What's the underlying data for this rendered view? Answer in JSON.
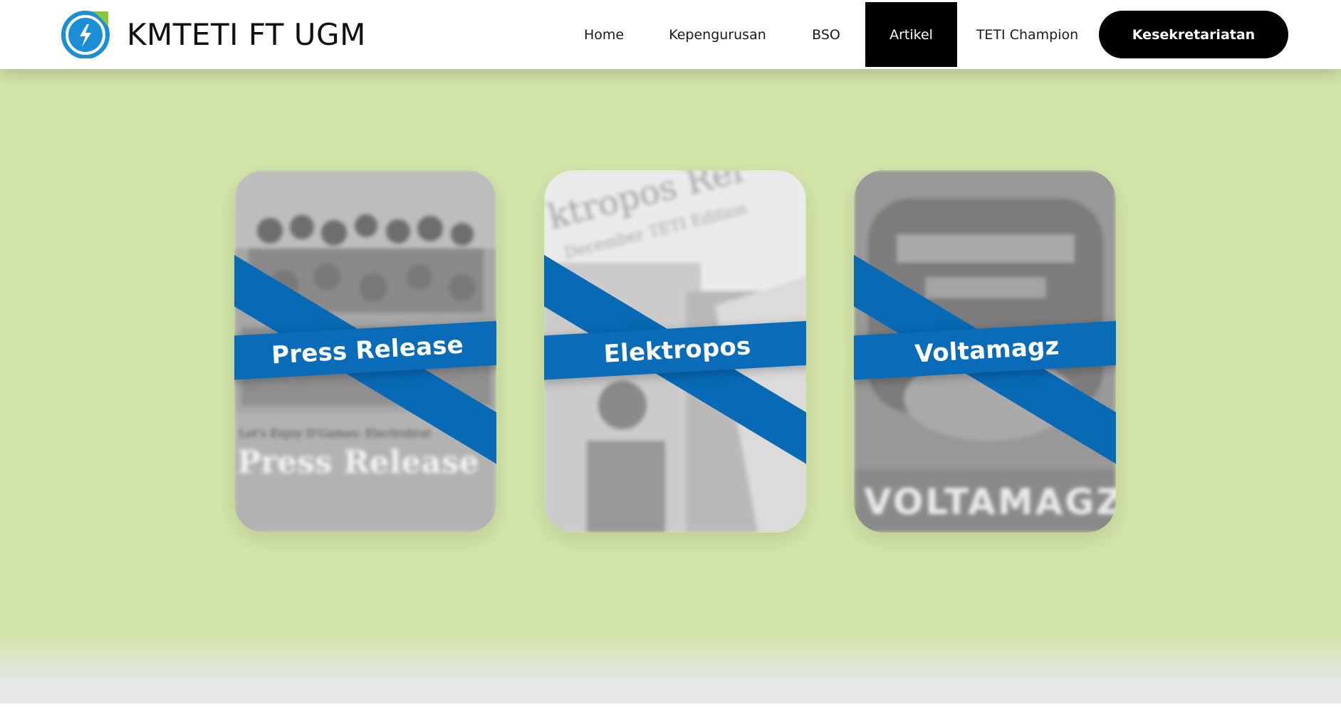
{
  "brand": {
    "name": "KMTETI FT UGM",
    "colors": {
      "ring": "#1a8fd6",
      "ring_dark": "#0a5fa3",
      "leaf": "#8cc63f"
    }
  },
  "nav": {
    "items": [
      {
        "label": "Home",
        "active": false
      },
      {
        "label": "Kepengurusan",
        "active": false
      },
      {
        "label": "BSO",
        "active": false
      },
      {
        "label": "Artikel",
        "active": true
      },
      {
        "label": "TETI Champion",
        "active": false
      }
    ],
    "cta_label": "Kesekretariatan"
  },
  "cards": [
    {
      "label": "Press Release",
      "image_text_a": "Let's Enjoy D'Games: Electrobrat",
      "image_text_b": "Press Release"
    },
    {
      "label": "Elektropos",
      "image_text_a": "ktropos Rel",
      "image_text_b": "December TETI Edition"
    },
    {
      "label": "Voltamagz",
      "image_text_a": "VOLTAMAGZ",
      "image_text_b": ""
    }
  ],
  "colors": {
    "background": "#d2e4a8",
    "ribbon": "#0a6cb8",
    "nav_active_bg": "#000000"
  }
}
